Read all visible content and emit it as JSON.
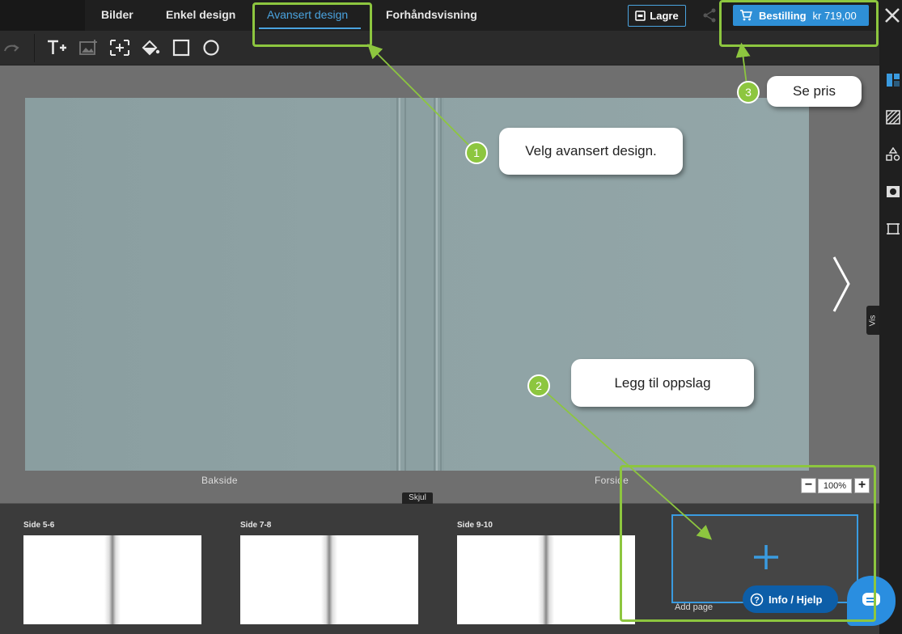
{
  "nav": {
    "tabs": [
      {
        "label": "Bilder"
      },
      {
        "label": "Enkel design"
      },
      {
        "label": "Avansert design"
      },
      {
        "label": "Forhåndsvisning"
      }
    ],
    "save_label": "Lagre",
    "order_label": "Bestilling",
    "price": "kr 719,00"
  },
  "toolbar": {
    "tools": [
      "add-text-icon",
      "add-image-icon",
      "add-frame-icon",
      "fill-icon",
      "rectangle-icon",
      "circle-icon"
    ]
  },
  "canvas": {
    "back_label": "Bakside",
    "front_label": "Forside",
    "vis_label": "Vis",
    "zoom": {
      "minus": "−",
      "value": "100%",
      "plus": "+"
    },
    "cover_color": "#8fa3a5"
  },
  "filmstrip": {
    "hide_label": "Skjul",
    "pages": [
      {
        "label": "Side 5-6"
      },
      {
        "label": "Side 7-8"
      },
      {
        "label": "Side 9-10"
      }
    ],
    "add_page_label": "Add page"
  },
  "annotations": {
    "callout_1": {
      "number": "1",
      "text": "Velg avansert design."
    },
    "callout_2": {
      "number": "2",
      "text": "Legg til oppslag"
    },
    "callout_3": {
      "number": "3",
      "text": "Se pris"
    },
    "highlight_color": "#8dc63f"
  },
  "help": {
    "label": "Info / Hjelp"
  },
  "sidebar": {
    "icons": [
      "layout-icon",
      "pattern-icon",
      "shapes-icon",
      "mask-icon",
      "frame-icon"
    ]
  },
  "colors": {
    "accent": "#4aa3df",
    "order_button": "#2e8fd6",
    "help_button": "#0d5ea8"
  }
}
